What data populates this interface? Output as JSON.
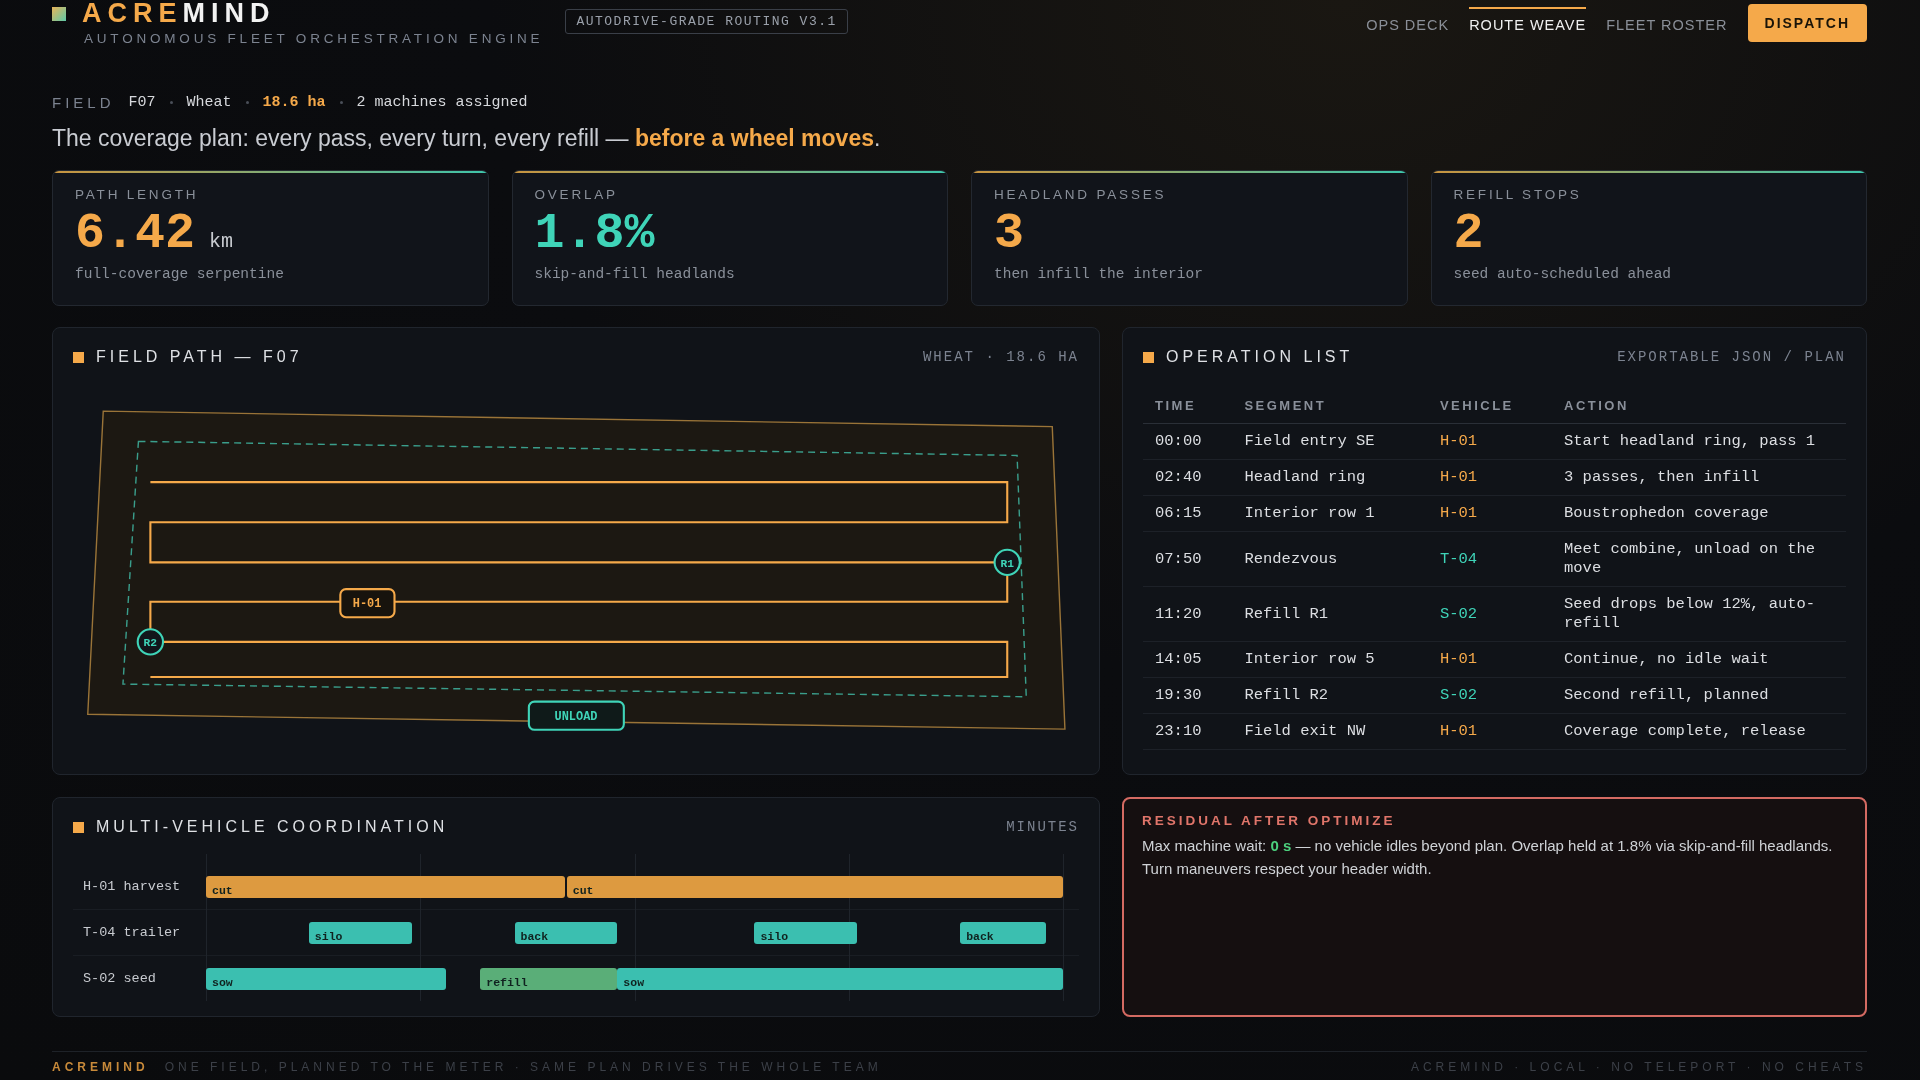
{
  "brand": {
    "first": "ACRE",
    "second": "MIND",
    "tagline": "AUTONOMOUS FLEET ORCHESTRATION ENGINE"
  },
  "version_badge": "AUTODRIVE-GRADE ROUTING V3.1",
  "nav": [
    {
      "label": "OPS DECK",
      "selected": false
    },
    {
      "label": "ROUTE WEAVE",
      "selected": true
    },
    {
      "label": "FLEET ROSTER",
      "selected": false
    }
  ],
  "primary_button": "DISPATCH",
  "field_line": {
    "label": "FIELD",
    "field": "F07",
    "crop": "Wheat",
    "area": "18.6 ha",
    "machines": "2 machines assigned"
  },
  "headline": {
    "text": "The coverage plan: every pass, every turn, every refill — ",
    "highlight": "before a wheel moves",
    "end": "."
  },
  "kpis": [
    {
      "label": "PATH LENGTH",
      "value": "6.42",
      "unit": "km",
      "note": "full-coverage serpentine",
      "color": "#f5a94a"
    },
    {
      "label": "OVERLAP",
      "value": "1.8%",
      "note": "skip-and-fill headlands",
      "color": "#3fd4b8"
    },
    {
      "label": "HEADLAND PASSES",
      "value": "3",
      "note": "then infill the interior",
      "color": "#f5a94a"
    },
    {
      "label": "REFILL STOPS",
      "value": "2",
      "note": "seed auto-scheduled ahead",
      "color": "#f5a94a"
    }
  ],
  "field_path": {
    "title": "FIELD PATH — F07",
    "meta": "WHEAT · 18.6 HA",
    "markers": [
      {
        "label": "R1",
        "kind": "refill"
      },
      {
        "label": "R2",
        "kind": "refill"
      }
    ],
    "vehicle_tag": "H-01",
    "unload_tag": "UNLOAD"
  },
  "operations": {
    "title": "OPERATION LIST",
    "meta": "EXPORTABLE JSON / PLAN",
    "columns": [
      "TIME",
      "SEGMENT",
      "VEHICLE",
      "ACTION"
    ],
    "rows": [
      {
        "time": "00:00",
        "segment": "Field entry SE",
        "vehicle": "H-01",
        "color": "#f5a94a",
        "action": "Start headland ring, pass 1"
      },
      {
        "time": "02:40",
        "segment": "Headland ring",
        "vehicle": "H-01",
        "color": "#f5a94a",
        "action": "3 passes, then infill"
      },
      {
        "time": "06:15",
        "segment": "Interior row 1",
        "vehicle": "H-01",
        "color": "#f5a94a",
        "action": "Boustrophedon coverage"
      },
      {
        "time": "07:50",
        "segment": "Rendezvous",
        "vehicle": "T-04",
        "color": "#3fd4b8",
        "action": "Meet combine, unload on the move"
      },
      {
        "time": "11:20",
        "segment": "Refill R1",
        "vehicle": "S-02",
        "color": "#3fd4b8",
        "action": "Seed drops below 12%, auto-refill"
      },
      {
        "time": "14:05",
        "segment": "Interior row 5",
        "vehicle": "H-01",
        "color": "#f5a94a",
        "action": "Continue, no idle wait"
      },
      {
        "time": "19:30",
        "segment": "Refill R2",
        "vehicle": "S-02",
        "color": "#3fd4b8",
        "action": "Second refill, planned"
      },
      {
        "time": "23:10",
        "segment": "Field exit NW",
        "vehicle": "H-01",
        "color": "#f5a94a",
        "action": "Coverage complete, release"
      }
    ]
  },
  "coordination": {
    "title": "MULTI-VEHICLE COORDINATION",
    "meta": "MINUTES",
    "lanes": [
      {
        "label": "H-01 harvest",
        "bars": [
          {
            "label": "cut",
            "color": "#dd9a40"
          },
          {
            "label": "cut",
            "color": "#dd9a40"
          }
        ]
      },
      {
        "label": "T-04 trailer",
        "bars": [
          {
            "label": "silo",
            "color": "#3bbfb0"
          },
          {
            "label": "back",
            "color": "#3bbfb0"
          },
          {
            "label": "silo",
            "color": "#3bbfb0"
          },
          {
            "label": "back",
            "color": "#3bbfb0"
          }
        ]
      },
      {
        "label": "S-02 seed",
        "bars": [
          {
            "label": "sow",
            "color": "#3bbfb0"
          },
          {
            "label": "refill",
            "color": "#5aae78"
          },
          {
            "label": "sow",
            "color": "#3bbfb0"
          }
        ]
      }
    ]
  },
  "residual": {
    "title": "RESIDUAL AFTER OPTIMIZE",
    "lead": "Max machine wait: ",
    "value": "0 s",
    "text": " — no vehicle idles beyond plan. Overlap held at 1.8% via skip-and-fill headlands. Turn maneuvers respect your header width."
  },
  "footer": {
    "brand": "ACREMIND",
    "tagline": "ONE FIELD, PLANNED TO THE METER · SAME PLAN DRIVES THE WHOLE TEAM",
    "right": "ACREMIND · LOCAL · NO TELEPORT · NO CHEATS"
  }
}
